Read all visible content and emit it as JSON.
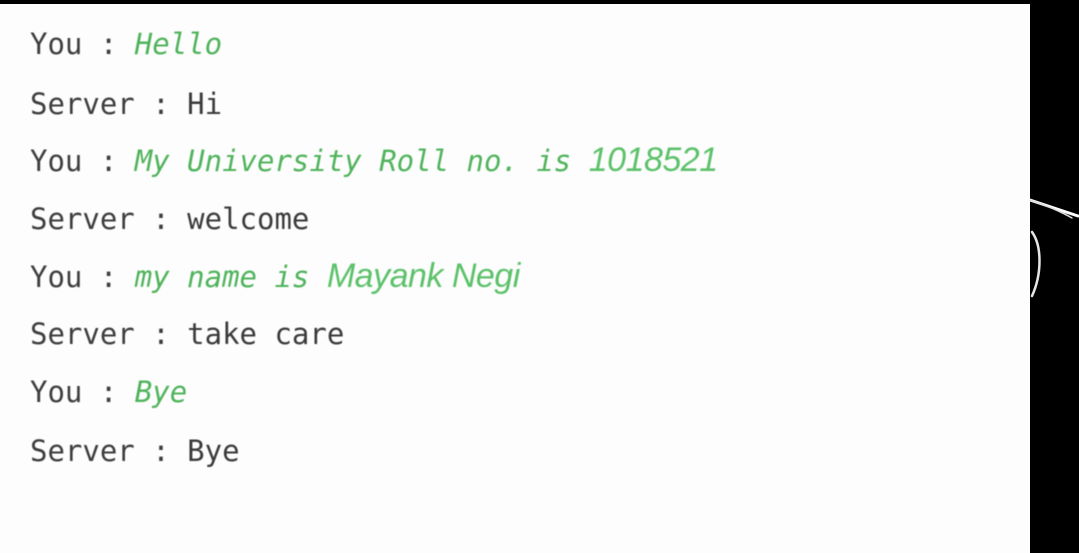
{
  "transcript": [
    {
      "speaker": "You",
      "separator": " : ",
      "message": "Hello",
      "overlay": ""
    },
    {
      "speaker": "Server",
      "separator": " : ",
      "message": "Hi",
      "overlay": ""
    },
    {
      "speaker": "You",
      "separator": " : ",
      "message": "My University Roll no. is ",
      "overlay": "1018521"
    },
    {
      "speaker": "Server",
      "separator": " : ",
      "message": "welcome",
      "overlay": ""
    },
    {
      "speaker": "You",
      "separator": " : ",
      "message": "my name is ",
      "overlay": "Mayank Negi"
    },
    {
      "speaker": "Server",
      "separator": " : ",
      "message": "take care",
      "overlay": ""
    },
    {
      "speaker": "You",
      "separator": " : ",
      "message": "Bye",
      "overlay": ""
    },
    {
      "speaker": "Server",
      "separator": " : ",
      "message": "Bye",
      "overlay": ""
    }
  ],
  "colors": {
    "background": "#000000",
    "console": "#fdfdfd",
    "text": "#3a3a3a",
    "you_message": "#4fb35b",
    "overlay_text": "#5cc16a"
  }
}
